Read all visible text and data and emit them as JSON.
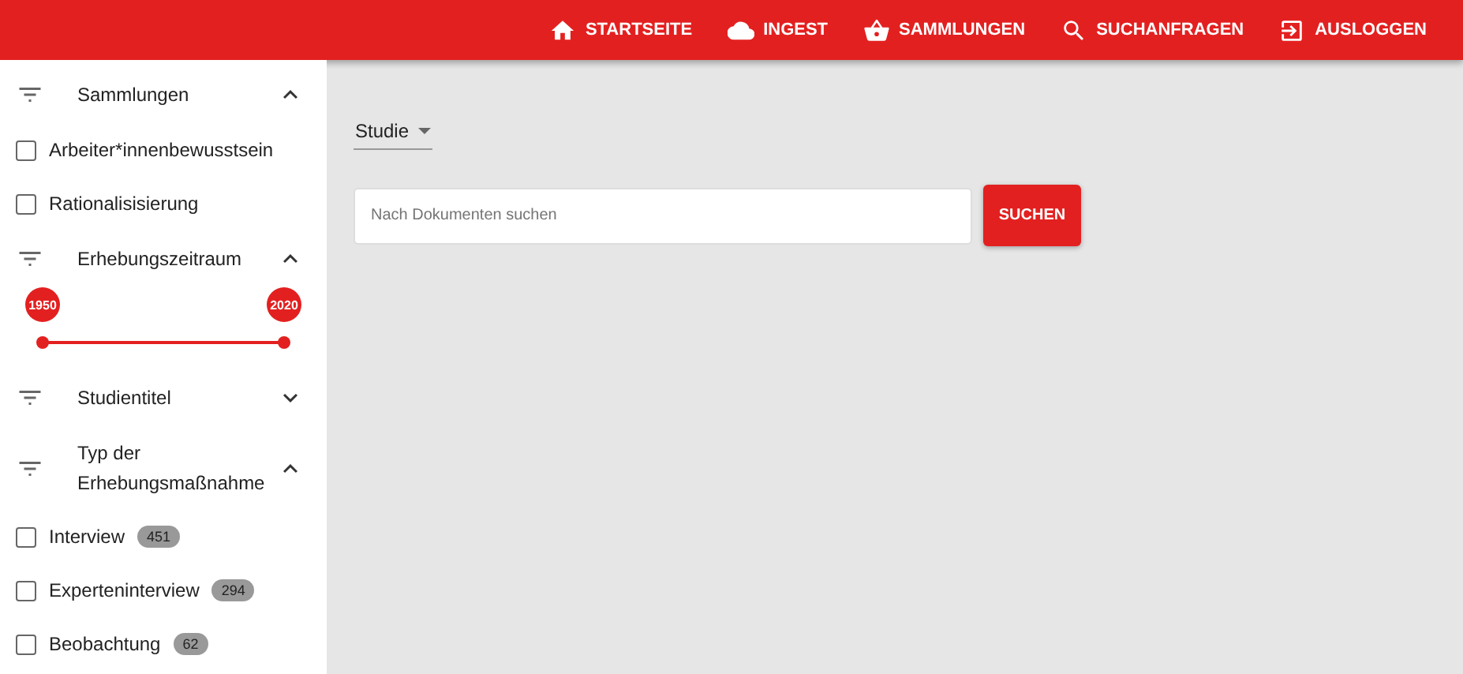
{
  "nav": [
    {
      "kind": "home",
      "label": "STARTSEITE"
    },
    {
      "kind": "cloud",
      "label": "INGEST"
    },
    {
      "kind": "basket",
      "label": "SAMMLUNGEN"
    },
    {
      "kind": "search",
      "label": "SUCHANFRAGEN"
    },
    {
      "kind": "logout",
      "label": "AUSLOGGEN"
    }
  ],
  "filters": [
    {
      "kind": "checkboxes",
      "title": "Sammlungen",
      "expanded": true,
      "items": [
        {
          "label": "Arbeiter*innenbewusstsein",
          "checked": false
        },
        {
          "label": "Rationalisisierung",
          "checked": false
        }
      ]
    },
    {
      "kind": "range",
      "title": "Erhebungszeitraum",
      "expanded": true,
      "thumbs": [
        {
          "label": "1950",
          "level": 0
        },
        {
          "label": "2020",
          "level": 1
        }
      ]
    },
    {
      "title": "Studientitel",
      "expanded": false
    },
    {
      "kind": "checkboxes",
      "title": "Typ der Erhebungsmaßnahme",
      "expanded": true,
      "items": [
        {
          "label": "Interview",
          "count": "451",
          "checked": false
        },
        {
          "label": "Experteninterview",
          "count": "294",
          "checked": false
        },
        {
          "label": "Beobachtung",
          "count": "62",
          "checked": false
        }
      ]
    }
  ],
  "scope": {
    "value": "Studie"
  },
  "search": {
    "placeholder": "Nach Dokumenten suchen",
    "button": "SUCHEN"
  }
}
